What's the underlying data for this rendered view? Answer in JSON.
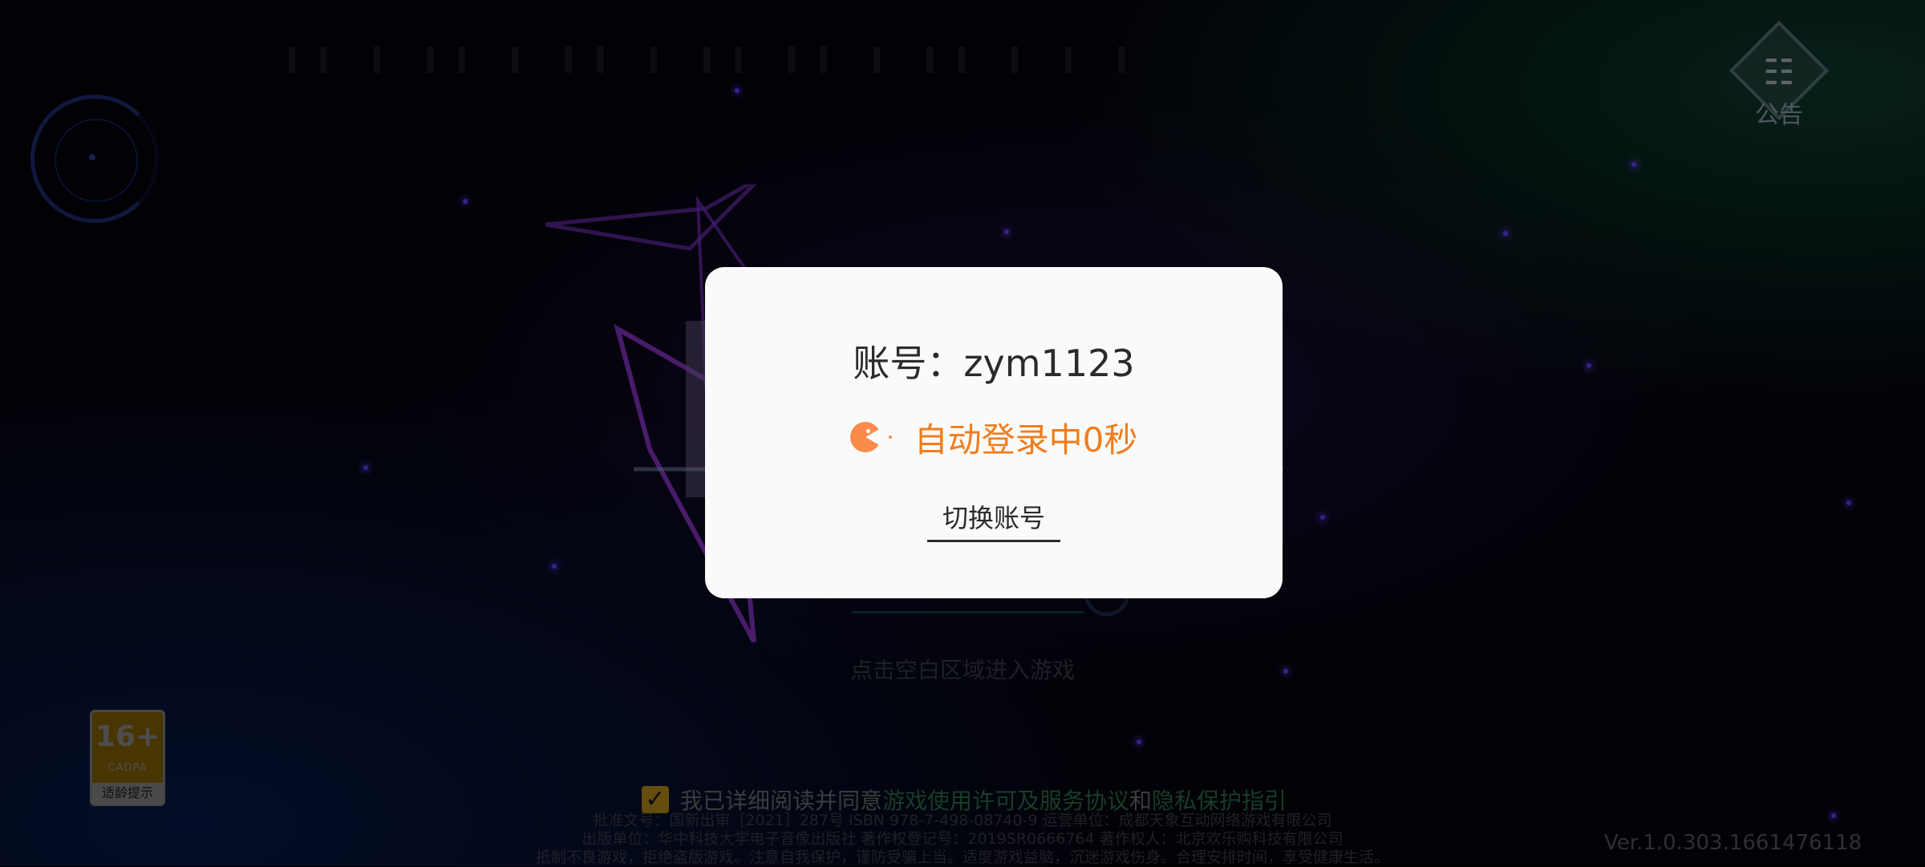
{
  "background": {
    "notice_label": "公告",
    "enter_hint": "点击空白区域进入游戏",
    "age_badge": {
      "rating": "16+",
      "org": "CADPA",
      "tip": "适龄提示"
    },
    "agreement": {
      "prefix": "我已详细阅读并同意",
      "license_link": "游戏使用许可及服务协议",
      "conjunction": "和",
      "privacy_link": "隐私保护指引"
    },
    "legal_lines": [
      "批准文号：国新出审［2021］287号 ISBN 978-7-498-08740-9 运营单位：成都天象互动网络游戏有限公司",
      "出版单位：华中科技大学电子音像出版社 著作权登记号：2019SR0666764 著作权人：北京欢乐购科技有限公司",
      "抵制不良游戏，拒绝盗版游戏。注意自我保护，谨防受骗上当。适度游戏益脑，沉迷游戏伤身。合理安排时间，享受健康生活。"
    ],
    "version": "Ver.1.0.303.1661476118"
  },
  "dialog": {
    "account": "账号：zym1123",
    "auto_login": "自动登录中0秒",
    "switch_account": "切换账号"
  },
  "colors": {
    "accent_orange": "#f07d1e",
    "loader_orange": "#fa8b4a",
    "agreement_link": "#2f6e47",
    "dialog_bg": "#fafafa"
  }
}
